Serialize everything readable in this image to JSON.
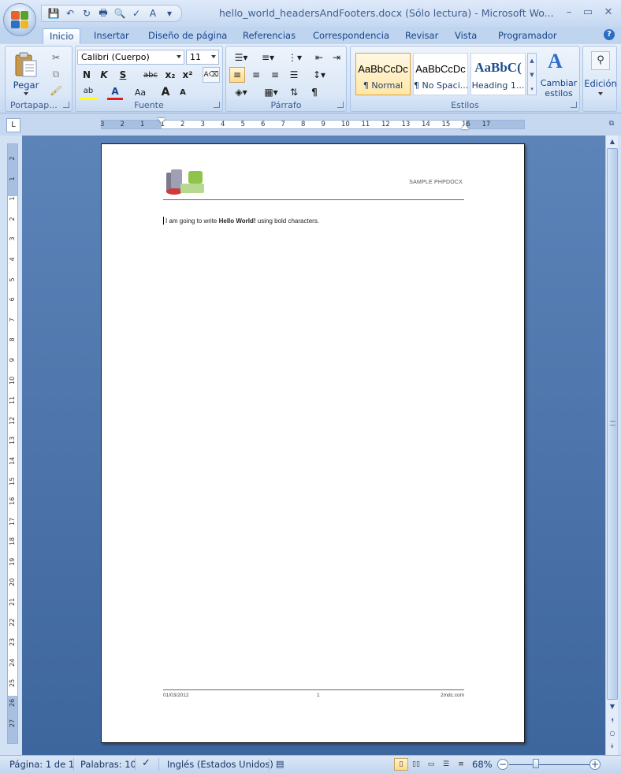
{
  "window": {
    "title": "hello_world_headersAndFooters.docx (Sólo lectura) - Microsoft Wo...",
    "minimize_glyph": "–",
    "maximize_glyph": "▭",
    "close_glyph": "✕"
  },
  "quick_access": [
    {
      "name": "save-icon",
      "glyph": "💾"
    },
    {
      "name": "undo-icon",
      "glyph": "↶"
    },
    {
      "name": "redo-icon",
      "glyph": "↻"
    },
    {
      "name": "print-icon",
      "glyph": "🖶"
    },
    {
      "name": "print-preview-icon",
      "glyph": "🔍"
    },
    {
      "name": "spelling-icon",
      "glyph": "✓"
    },
    {
      "name": "text-style-icon",
      "glyph": "A"
    },
    {
      "name": "customize-icon",
      "glyph": "▾"
    }
  ],
  "tabs": [
    {
      "label": "Inicio",
      "active": true
    },
    {
      "label": "Insertar"
    },
    {
      "label": "Diseño de página"
    },
    {
      "label": "Referencias"
    },
    {
      "label": "Correspondencia"
    },
    {
      "label": "Revisar"
    },
    {
      "label": "Vista"
    },
    {
      "label": "Programador"
    }
  ],
  "ribbon": {
    "clipboard": {
      "label": "Portapap...",
      "paste_label": "Pegar"
    },
    "font": {
      "label": "Fuente",
      "font_name": "Calibri (Cuerpo)",
      "font_size": "11",
      "bold": "N",
      "italic": "K",
      "underline": "S",
      "strike": "abc",
      "subscript": "x₂",
      "superscript": "x²",
      "change_case": "Aa",
      "grow": "A",
      "shrink": "A",
      "highlight": "ab",
      "font_color": "A"
    },
    "paragraph": {
      "label": "Párrafo",
      "pilcrow": "¶"
    },
    "styles": {
      "label": "Estilos",
      "items": [
        {
          "sample": "AaBbCcDc",
          "name": "¶ Normal",
          "selected": true
        },
        {
          "sample": "AaBbCcDc",
          "name": "¶ No Spaci..."
        },
        {
          "sample": "AaBbC(",
          "name": "Heading 1..."
        }
      ],
      "change_styles_line1": "Cambiar",
      "change_styles_line2": "estilos"
    },
    "editing": {
      "label": "Edición"
    }
  },
  "ruler": {
    "h_numbers": [
      "3",
      "2",
      "1",
      "1",
      "2",
      "3",
      "4",
      "5",
      "6",
      "7",
      "8",
      "9",
      "10",
      "11",
      "12",
      "13",
      "14",
      "15",
      "16",
      "17"
    ],
    "v_numbers": [
      "2",
      "1",
      "1",
      "2",
      "3",
      "4",
      "5",
      "6",
      "7",
      "8",
      "9",
      "10",
      "11",
      "12",
      "13",
      "14",
      "15",
      "16",
      "17",
      "18",
      "19",
      "20",
      "21",
      "22",
      "23",
      "24",
      "25",
      "26",
      "27"
    ]
  },
  "document": {
    "header_text": "SAMPLE PHPDOCX",
    "body_prefix": "I am going to write ",
    "body_bold": "Hello World!",
    "body_suffix": " using bold  characters.",
    "footer_left": "01/03/2012",
    "footer_center": "1",
    "footer_right": "2mdc.com"
  },
  "status": {
    "page": "Página: 1 de 1",
    "words": "Palabras: 10",
    "language": "Inglés (Estados Unidos)",
    "zoom": "68%"
  },
  "colors": {
    "accent": "#15428b",
    "doc_background": "#4a72a8",
    "selected_style": "#ffe7a8"
  }
}
